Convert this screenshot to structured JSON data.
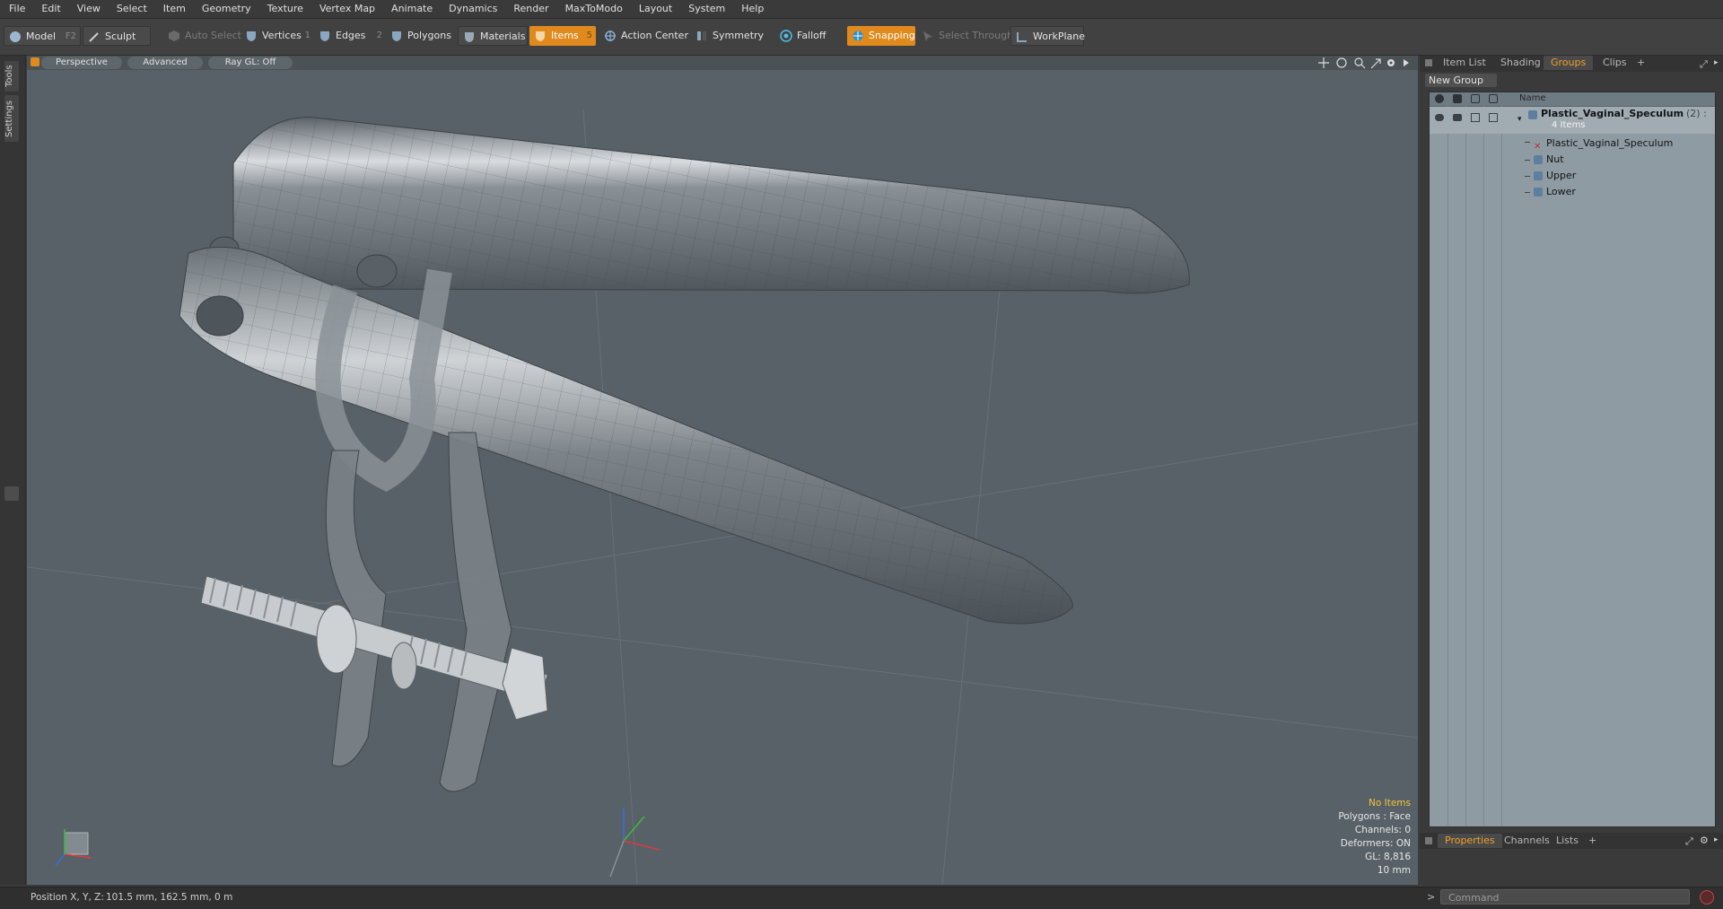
{
  "menu": [
    "File",
    "Edit",
    "View",
    "Select",
    "Item",
    "Geometry",
    "Texture",
    "Vertex Map",
    "Animate",
    "Dynamics",
    "Render",
    "MaxToModo",
    "Layout",
    "System",
    "Help"
  ],
  "toolbar": {
    "model": "Model",
    "model_key": "F2",
    "sculpt": "Sculpt",
    "auto_select": "Auto Select",
    "vertices": "Vertices",
    "vertices_key": "1",
    "edges": "Edges",
    "edges_key": "2",
    "polygons": "Polygons",
    "materials": "Materials",
    "items": "Items",
    "items_key": "5",
    "action_center": "Action Center",
    "symmetry": "Symmetry",
    "falloff": "Falloff",
    "snapping": "Snapping",
    "select_through": "Select Through",
    "workplane": "WorkPlane"
  },
  "left_tabs": [
    "Tools",
    "Settings"
  ],
  "viewport": {
    "view_mode": "Perspective",
    "shading": "Advanced",
    "raygl": "Ray GL: Off",
    "hud": {
      "selection": "No Items",
      "polygons": "Polygons : Face",
      "channels": "Channels: 0",
      "deformers": "Deformers: ON",
      "gl": "GL: 8,816",
      "scale": "10 mm"
    }
  },
  "right_panel": {
    "tabs": [
      "Item List",
      "Shading",
      "Groups",
      "Clips",
      "+"
    ],
    "active_tab": "Groups",
    "new_group": "New Group",
    "column_name": "Name",
    "group": {
      "name": "Plastic_Vaginal_Speculum",
      "count": "(2) :",
      "items_count": "4 Items"
    },
    "children": [
      "Plastic_Vaginal_Speculum",
      "Nut",
      "Upper",
      "Lower"
    ],
    "bottom_tabs": [
      "Properties",
      "Channels",
      "Lists",
      "+"
    ],
    "active_bottom_tab": "Properties"
  },
  "status": {
    "position_label": "Position X, Y, Z:",
    "position_value": "101.5 mm, 162.5 mm, 0 m"
  },
  "command": {
    "placeholder": "Command",
    "prompt": ">"
  },
  "colors": {
    "accent": "#e08a1e",
    "viewport_bg": "#576167",
    "active_tab": "#f0a02a"
  }
}
